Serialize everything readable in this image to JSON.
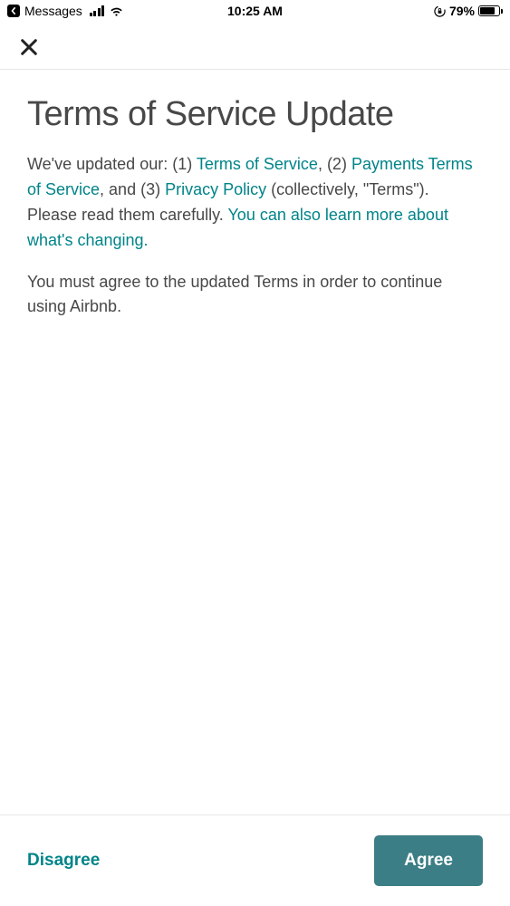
{
  "statusBar": {
    "app": "Messages",
    "time": "10:25 AM",
    "batteryPercent": "79%"
  },
  "page": {
    "title": "Terms of Service Update",
    "paragraph1": {
      "part1": "We've updated our: (1) ",
      "link1": "Terms of Service",
      "part2": ", (2) ",
      "link2": "Payments Terms of Service",
      "part3": ", and (3) ",
      "link3": "Privacy Policy",
      "part4": " (collectively, \"Terms\"). Please read them carefully. ",
      "link4": "You can also learn more about what's changing.",
      "part5": ""
    },
    "paragraph2": "You must agree to the updated Terms in order to continue using Airbnb."
  },
  "footer": {
    "disagree": "Disagree",
    "agree": "Agree"
  }
}
